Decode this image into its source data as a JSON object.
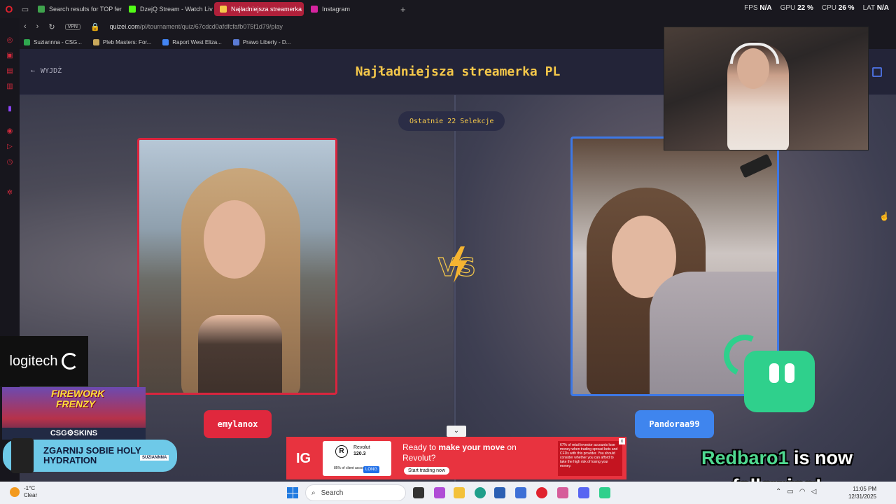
{
  "browser": {
    "tabs": [
      {
        "label": "Search results for TOP fem",
        "color": "#3fa34d"
      },
      {
        "label": "DzejQ Stream - Watch Live",
        "color": "#53fc18"
      },
      {
        "label": "Najładniejsza streamerka",
        "color": "#f5c84a",
        "active": true
      },
      {
        "label": "Instagram",
        "color": "#d6249f"
      }
    ],
    "new_tab": "+",
    "vpn_label": "VPN",
    "url_host": "quizei.com",
    "url_path": "/pl/tournament/quiz/67cdcd0afdfcfafb075f1d79/play",
    "bookmarks": [
      {
        "label": "Suziannna - CSG...",
        "color": "#2fa84f"
      },
      {
        "label": "Pleb Masters: For...",
        "color": "#c9a85b"
      },
      {
        "label": "Raport West Eliza...",
        "color": "#4285f4"
      },
      {
        "label": "Prawo Liberty - D...",
        "color": "#5b7bd5"
      }
    ],
    "perf": {
      "fps_label": "FPS",
      "fps_value": "N/A",
      "gpu_label": "GPU",
      "gpu_value": "22 %",
      "cpu_label": "CPU",
      "cpu_value": "26 %",
      "lat_label": "LAT",
      "lat_value": "N/A"
    },
    "ai_label": "AI"
  },
  "quiz": {
    "exit_label": "WYJDŹ",
    "title": "Najładniejsza streamerka PL",
    "selections_label": "Ostatnie 22 Selekcje",
    "vs_label": "VS",
    "left": {
      "name": "emylanox",
      "accent": "#d9253e"
    },
    "right": {
      "name": "Pandoraa99",
      "accent": "#3d78e6"
    }
  },
  "ad": {
    "brand_tag": "IG",
    "card_symbol": "R",
    "card_name": "Revolut",
    "card_price": "120.3",
    "card_note": "85% of client accounts are",
    "card_button": "LONG",
    "headline_pre": "Ready to ",
    "headline_bold": "make your move",
    "headline_post": " on Revolut?",
    "cta": "Start trading now",
    "disclaimer": "67% of retail investor accounts lose money when trading spread bets and CFDs with this provider. You should consider whether you can afford to take the high risk of losing your money.",
    "close": "x"
  },
  "overlay": {
    "logitech_label": "logitech",
    "game_title": "FIREWORK FRENZY",
    "csg_label": "CSG⚙SKINS",
    "hydration_text": "ZGARNIJ SOBIE HOLY HYDRATION",
    "hydration_tag": "SUZIANNNA",
    "follow_user": "Redbaro1",
    "follow_text": " is now following!"
  },
  "taskbar": {
    "weather_temp": "-1°C",
    "weather_desc": "Clear",
    "weather_badge": "1",
    "search_label": "Search",
    "time": "11:05 PM",
    "date": "12/31/2025"
  }
}
